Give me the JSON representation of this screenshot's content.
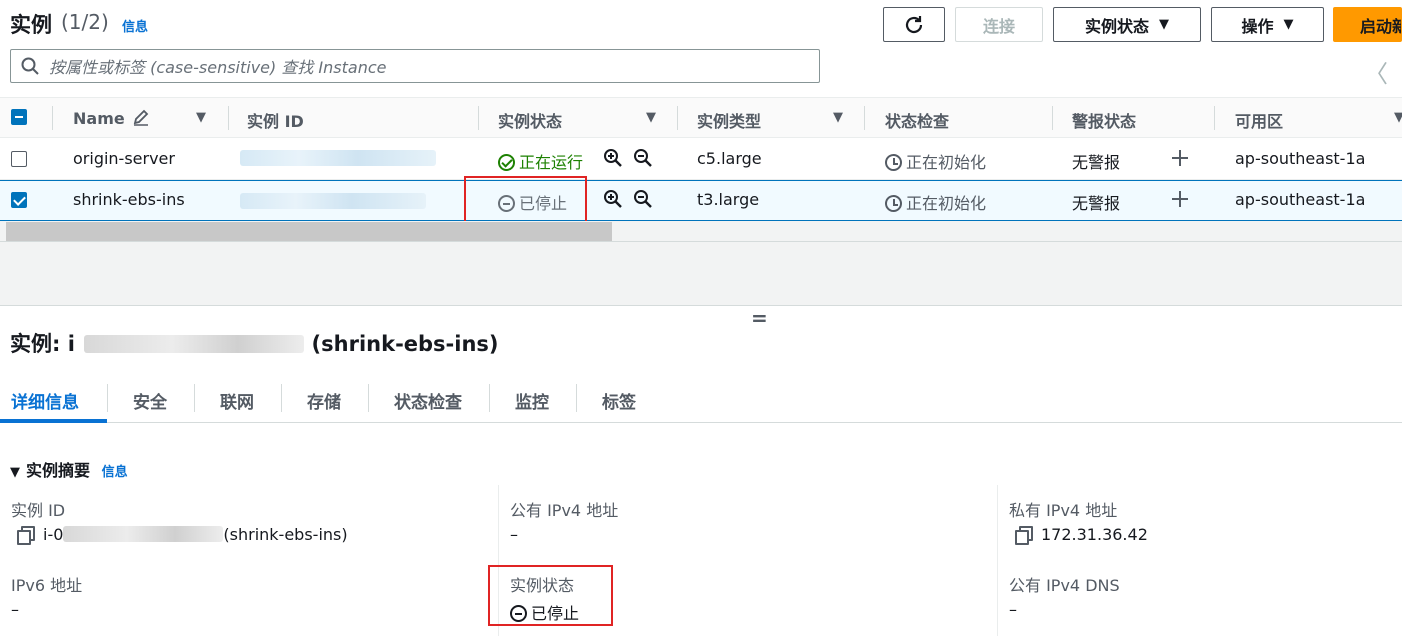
{
  "header": {
    "title": "实例",
    "count": "(1/2)",
    "info": "信息",
    "refresh_icon": "refresh-icon",
    "connect_label": "连接",
    "instance_state_label": "实例状态",
    "actions_label": "操作",
    "launch_label": "启动新"
  },
  "search": {
    "placeholder": "按属性或标签 (case-sensitive) 查找 Instance"
  },
  "table": {
    "columns": [
      "Name",
      "实例 ID",
      "实例状态",
      "实例类型",
      "状态检查",
      "警报状态",
      "可用区"
    ],
    "rows": [
      {
        "name": "origin-server",
        "state": "正在运行",
        "type": "c5.large",
        "check": "正在初始化",
        "alarm": "无警报",
        "az": "ap-southeast-1a",
        "selected": false
      },
      {
        "name": "shrink-ebs-ins",
        "state": "已停止",
        "type": "t3.large",
        "check": "正在初始化",
        "alarm": "无警报",
        "az": "ap-southeast-1a",
        "selected": true
      }
    ]
  },
  "detail": {
    "title_prefix": "实例: i",
    "title_suffix": "(shrink-ebs-ins)",
    "tabs": [
      "详细信息",
      "安全",
      "联网",
      "存储",
      "状态检查",
      "监控",
      "标签"
    ],
    "section_title": "实例摘要",
    "section_info": "信息",
    "fields": {
      "instance_id_label": "实例 ID",
      "instance_id_prefix": "i-0",
      "instance_id_suffix": "(shrink-ebs-ins)",
      "public_ipv4_label": "公有 IPv4 地址",
      "public_ipv4_value": "–",
      "private_ipv4_label": "私有 IPv4 地址",
      "private_ipv4_value": "172.31.36.42",
      "ipv6_label": "IPv6 地址",
      "ipv6_value": "–",
      "state_label": "实例状态",
      "state_value": "已停止",
      "public_dns_label": "公有 IPv4 DNS",
      "public_dns_value": "–"
    }
  },
  "colors": {
    "accent": "#0972d3",
    "primary_button": "#ff9900",
    "running": "#1d8102",
    "highlight_box": "#e02424"
  }
}
